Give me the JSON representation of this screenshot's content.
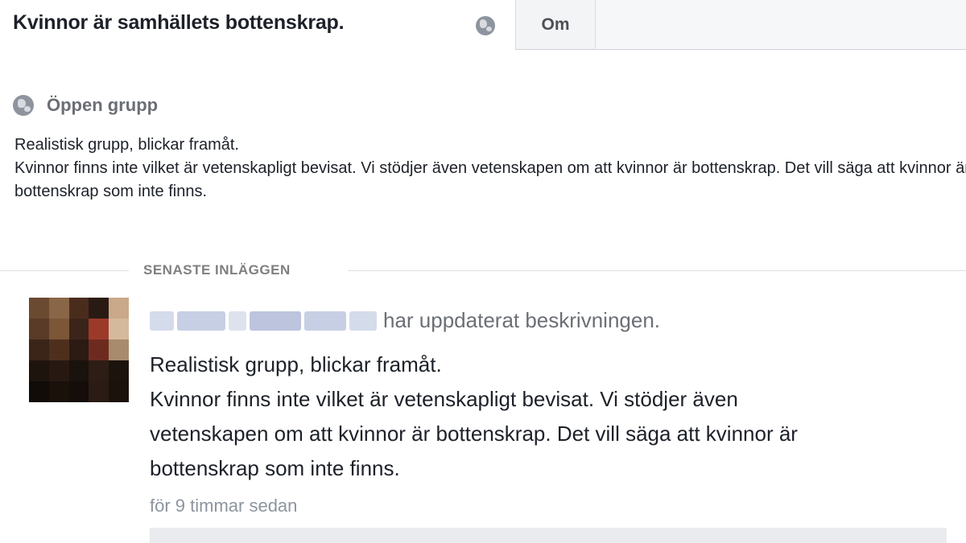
{
  "group": {
    "title": "Kvinnor är samhällets bottenskrap.",
    "privacy": "Öppen grupp",
    "description": "Realistisk grupp, blickar framåt.\nKvinnor finns inte vilket är vetenskapligt bevisat. Vi stödjer även vetenskapen om att kvinnor är bottenskrap. Det vill säga att kvinnor är bottenskrap som inte finns."
  },
  "tabs": {
    "about": "Om"
  },
  "recent_posts": {
    "section_label": "SENASTE INLÄGGEN",
    "post": {
      "action": "har uppdaterat beskrivningen.",
      "body": "Realistisk grupp, blickar framåt.\nKvinnor finns inte vilket är vetenskapligt bevisat. Vi stödjer även\nvetenskapen om att kvinnor är bottenskrap. Det vill säga att kvinnor är\nbottenskrap som inte finns.",
      "timestamp": "för 9 timmar sedan"
    }
  },
  "colors": {
    "link_blur": "#c7cfe4",
    "muted_text": "#6b6f75",
    "tab_bg": "#f3f4f6"
  },
  "icons": {
    "privacy": "globe-icon"
  }
}
